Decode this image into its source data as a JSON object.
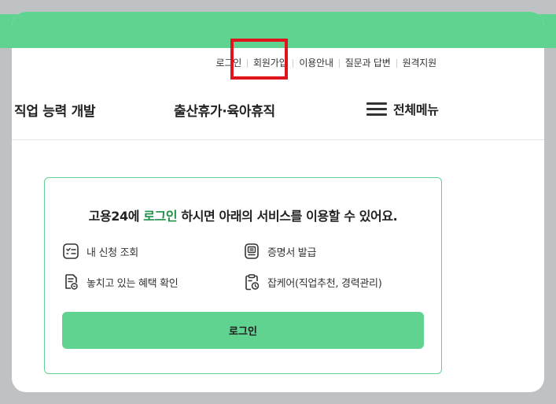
{
  "util_nav": {
    "items": [
      "로그인",
      "회원가입",
      "이용안내",
      "질문과 답변",
      "원격지원"
    ]
  },
  "main_nav": {
    "items": [
      "직업 능력 개발",
      "출산휴가·육아휴직"
    ],
    "menu_label": "전체메뉴"
  },
  "login_panel": {
    "title_prefix": "고용24에 ",
    "title_accent": "로그인",
    "title_suffix": " 하시면 아래의 서비스를 이용할 수 있어요.",
    "services": [
      {
        "label": "내 신청 조회",
        "icon": "checklist-icon"
      },
      {
        "label": "증명서 발급",
        "icon": "certificate-icon"
      },
      {
        "label": "놓치고 있는 혜택 확인",
        "icon": "document-search-icon"
      },
      {
        "label": "잡케어(직업추천, 경력관리)",
        "icon": "clipboard-clock-icon"
      }
    ],
    "button_label": "로그인"
  },
  "colors": {
    "brand_green": "#5fd38f",
    "accent_text_green": "#1f8f4a",
    "highlight_red": "#e0141c",
    "overlay_gray": "#bfc2c5"
  }
}
